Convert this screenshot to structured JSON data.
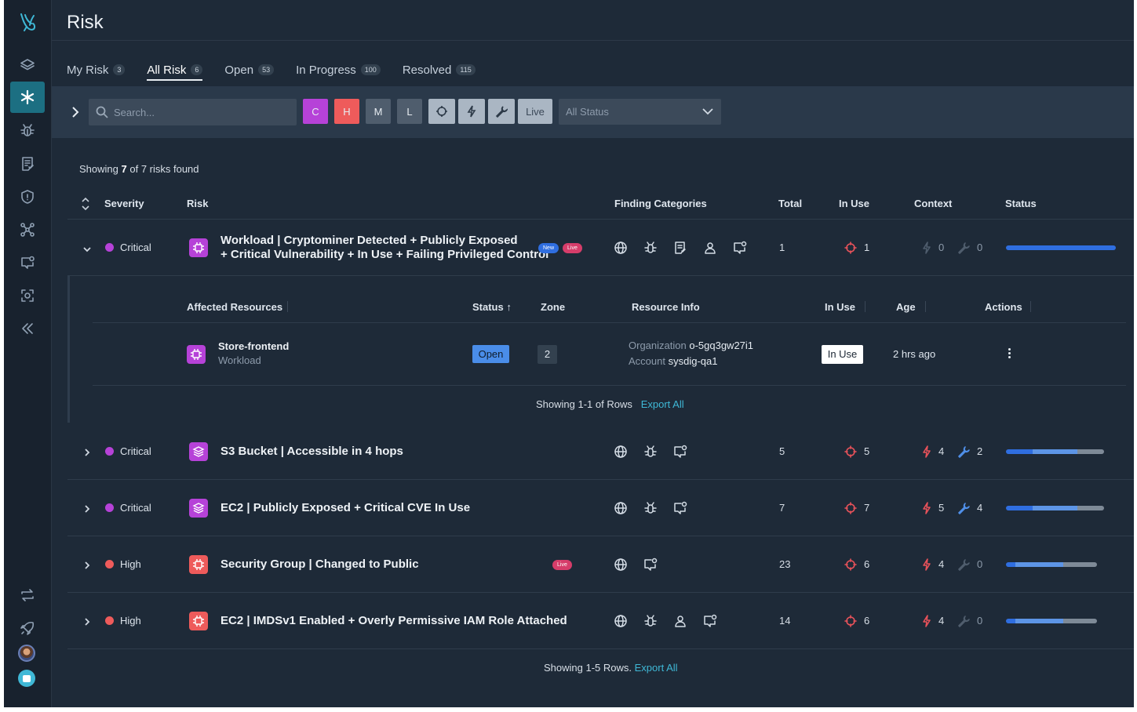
{
  "page": {
    "title": "Risk"
  },
  "sidebar": {
    "items": [
      {
        "icon": "logo-icon"
      },
      {
        "icon": "layers-icon"
      },
      {
        "icon": "asterisk-icon",
        "active": true
      },
      {
        "icon": "bug-icon"
      },
      {
        "icon": "report-icon"
      },
      {
        "icon": "shield-icon"
      },
      {
        "icon": "network-icon"
      },
      {
        "icon": "chat-icon"
      },
      {
        "icon": "scan-icon"
      },
      {
        "icon": "collapse-icon"
      },
      {
        "icon": "sync-icon"
      },
      {
        "icon": "rocket-icon"
      },
      {
        "icon": "user-avatar"
      },
      {
        "icon": "help-chat-icon"
      }
    ]
  },
  "tabs": [
    {
      "label": "My Risk",
      "count": "3"
    },
    {
      "label": "All Risk",
      "count": "6",
      "active": true
    },
    {
      "label": "Open",
      "count": "53"
    },
    {
      "label": "In Progress",
      "count": "100"
    },
    {
      "label": "Resolved",
      "count": "115"
    }
  ],
  "filters": {
    "search_placeholder": "Search...",
    "severity_chips": [
      "C",
      "H",
      "M",
      "L"
    ],
    "live_label": "Live",
    "status_placeholder": "All Status"
  },
  "summary": {
    "prefix": "Showing",
    "shown": "7",
    "suffix": "of 7 risks found"
  },
  "columns": {
    "severity": "Severity",
    "risk": "Risk",
    "finding_categories": "Finding Categories",
    "total": "Total",
    "in_use": "In Use",
    "context": "Context",
    "status": "Status"
  },
  "risks": [
    {
      "severity": "Critical",
      "title_line1": "Workload | Cryptominer Detected + Publicly Exposed",
      "title_line2": "+ Critical Vulnerability + In Use + Failing Privileged Control",
      "badges": [
        "New",
        "Live"
      ],
      "categories": [
        "globe-icon",
        "bug-icon",
        "report-icon",
        "user-icon",
        "chat-icon"
      ],
      "total": "1",
      "in_use": "1",
      "exploit": "0",
      "fix": "0",
      "status_progress": [
        1.0,
        0,
        0
      ]
    },
    {
      "severity": "Critical",
      "title_line1": "S3 Bucket | Accessible in 4 hops",
      "badges": [],
      "categories": [
        "globe-icon",
        "bug-icon",
        "chat-icon"
      ],
      "total": "5",
      "in_use": "5",
      "exploit": "4",
      "fix": "2",
      "status_progress": [
        0.27,
        0.46,
        0.27
      ]
    },
    {
      "severity": "Critical",
      "title_line1": "EC2 | Publicly Exposed + Critical CVE In Use",
      "badges": [],
      "categories": [
        "globe-icon",
        "bug-icon",
        "chat-icon"
      ],
      "total": "7",
      "in_use": "7",
      "exploit": "5",
      "fix": "4",
      "status_progress": [
        0.27,
        0.46,
        0.27
      ]
    },
    {
      "severity": "High",
      "title_line1": "Security Group | Changed to Public",
      "badges": [
        "Live"
      ],
      "categories": [
        "globe-icon",
        "chat-icon"
      ],
      "total": "23",
      "in_use": "6",
      "exploit": "4",
      "fix": "0",
      "status_progress": [
        0.1,
        0.53,
        0.37
      ]
    },
    {
      "severity": "High",
      "title_line1": "EC2 | IMDSv1 Enabled + Overly Permissive IAM Role Attached",
      "badges": [],
      "categories": [
        "globe-icon",
        "bug-icon",
        "user-icon",
        "chat-icon"
      ],
      "total": "14",
      "in_use": "6",
      "exploit": "4",
      "fix": "0",
      "status_progress": [
        0.1,
        0.53,
        0.37
      ]
    }
  ],
  "detail": {
    "columns": {
      "affected": "Affected Resources",
      "status": "Status",
      "zone": "Zone",
      "resource_info": "Resource Info",
      "in_use": "In Use",
      "age": "Age",
      "actions": "Actions"
    },
    "row": {
      "name": "Store-frontend",
      "type": "Workload",
      "status": "Open",
      "zone": "2",
      "org_label": "Organization",
      "org_value": "o-5gq3gw27i1",
      "account_label": "Account",
      "account_value": "sysdig-qa1",
      "in_use": "In Use",
      "age": "2 hrs ago"
    },
    "footer": "Showing 1-1 of Rows",
    "export": "Export All"
  },
  "footer": {
    "text": "Showing 1-5 Rows.",
    "export": "Export All"
  },
  "colors": {
    "critical": "#b642d8",
    "high": "#ee5b5b",
    "medium": "#4f5d6d",
    "low": "#4f5d6d",
    "accent": "#3fb8d6",
    "bar_blue": "#2f6ee0",
    "bar_light": "#5d95e6",
    "bar_gray": "#7e8a97"
  }
}
